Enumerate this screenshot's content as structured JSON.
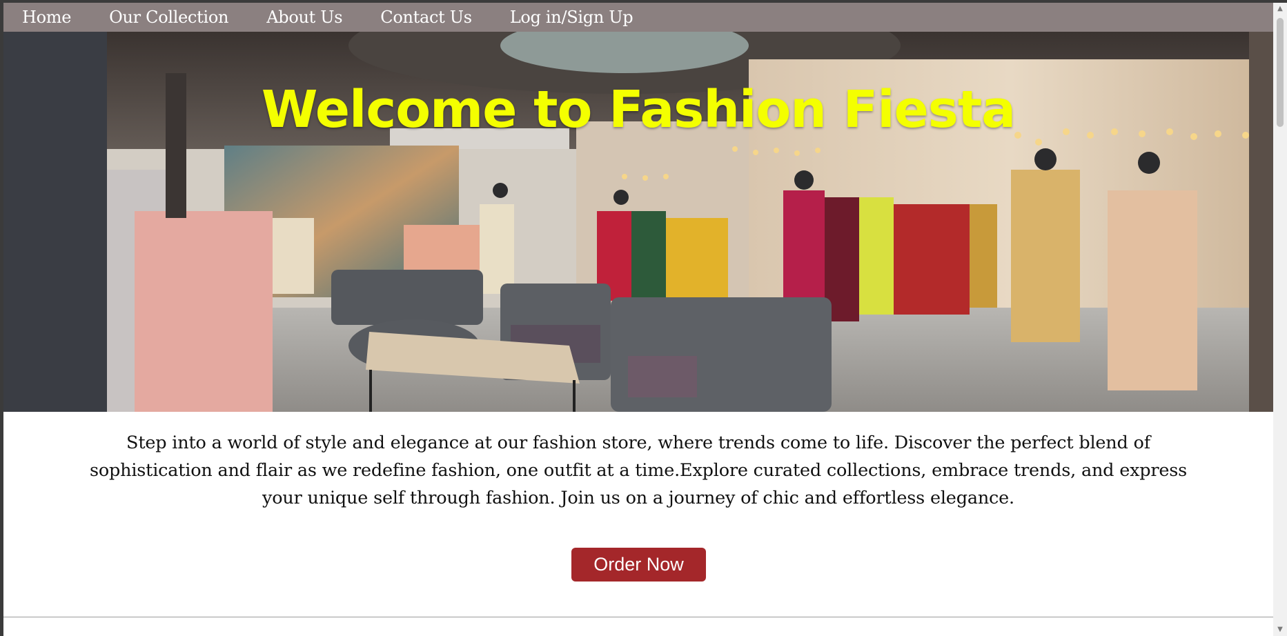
{
  "nav": {
    "items": [
      {
        "label": "Home"
      },
      {
        "label": "Our Collection"
      },
      {
        "label": "About Us"
      },
      {
        "label": "Contact Us"
      },
      {
        "label": "Log in/Sign Up"
      }
    ]
  },
  "hero": {
    "title": "Welcome to Fashion Fiesta",
    "title_color": "#f4ff00"
  },
  "intro": {
    "text": "Step into a world of style and elegance at our fashion store, where trends come to life. Discover the perfect blend of sophistication and flair as we redefine fashion, one outfit at a time.Explore curated collections, embrace trends, and express your unique self through fashion. Join us on a journey of chic and effortless elegance."
  },
  "cta": {
    "label": "Order Now",
    "color": "#a4272a"
  },
  "colors": {
    "nav_bg": "#8b8080"
  },
  "scrollbar": {
    "up_icon": "scroll-up-arrow",
    "down_icon": "scroll-down-arrow"
  }
}
